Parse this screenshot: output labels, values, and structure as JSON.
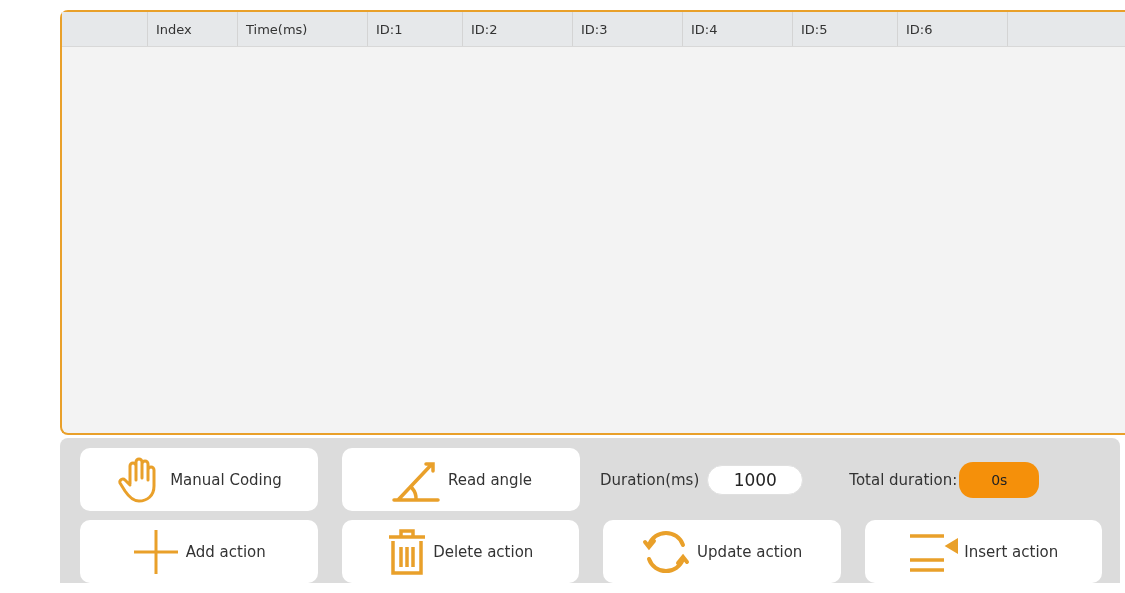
{
  "table": {
    "columns": [
      "Index",
      "Time(ms)",
      "ID:1",
      "ID:2",
      "ID:3",
      "ID:4",
      "ID:5",
      "ID:6"
    ]
  },
  "controls": {
    "top_buttons": [
      "Manual Coding",
      "Read angle"
    ],
    "duration": {
      "label": "Duration(ms)",
      "value": "1000"
    },
    "total_duration": {
      "label": "Total duration:",
      "value": "0s"
    },
    "bottom_buttons": [
      "Add action",
      "Delete action",
      "Update action",
      "Insert action"
    ]
  }
}
